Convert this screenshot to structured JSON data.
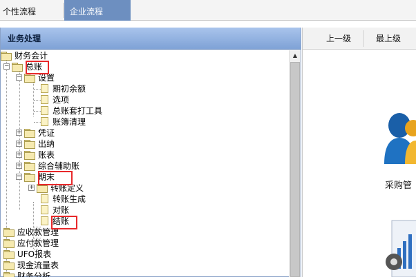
{
  "top_tabs": [
    "个性流程",
    "企业流程"
  ],
  "left_panel": {
    "title": "业务处理",
    "tree": {
      "root": "财务会计",
      "ledger": "总账",
      "setup": "设置",
      "setup_children": [
        "期初余额",
        "选项",
        "总账套打工具",
        "账簿清理"
      ],
      "voucher": "凭证",
      "cashier": "出纳",
      "reports": "账表",
      "aux_ledger": "综合辅助账",
      "period_end": "期末",
      "transfer_def": "转账定义",
      "period_end_children": [
        "转账生成",
        "对账",
        "结账"
      ],
      "receivables": "应收款管理",
      "payables": "应付款管理",
      "ufo": "UFO报表",
      "cashflow": "现金流量表",
      "fin_analysis": "财务分析"
    }
  },
  "right_panel": {
    "nav_up": "上一级",
    "nav_top": "最上级",
    "purchase_label": "采购管"
  },
  "colors": {
    "active_tab": "#6d8fc0",
    "panel_header": "#8fb0e0",
    "highlight_box": "#e8282a"
  }
}
